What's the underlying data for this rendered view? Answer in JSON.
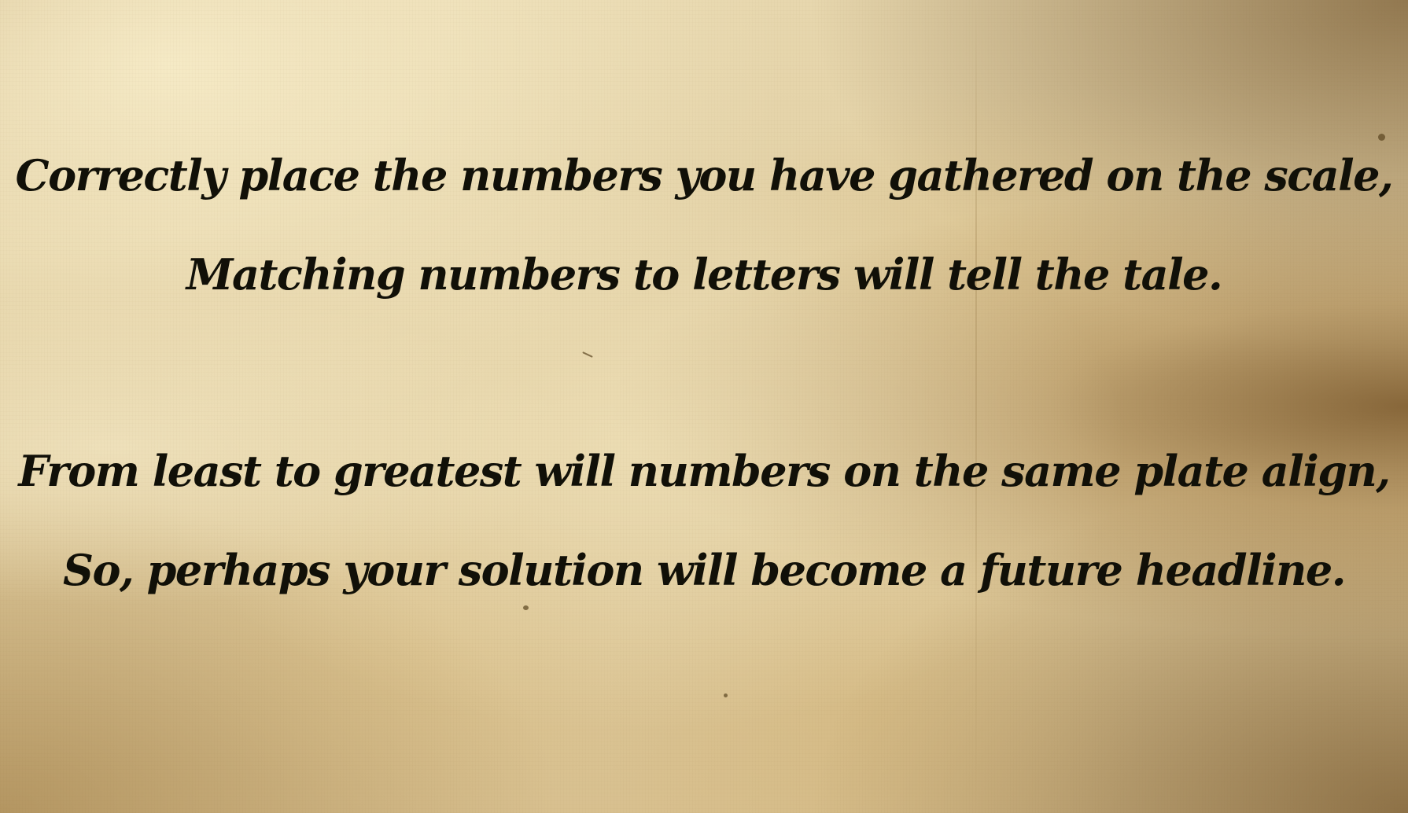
{
  "riddle": {
    "stanza_1": {
      "line_1": "Correctly place the numbers you have gathered on the scale,",
      "line_2": "Matching numbers to letters will tell the tale."
    },
    "stanza_2": {
      "line_1": "From least to greatest will numbers on the same plate align,",
      "line_2": "So, perhaps your solution will become a future headline."
    }
  },
  "colors": {
    "parchment": "#e3d2a6",
    "ink": "#111008"
  }
}
